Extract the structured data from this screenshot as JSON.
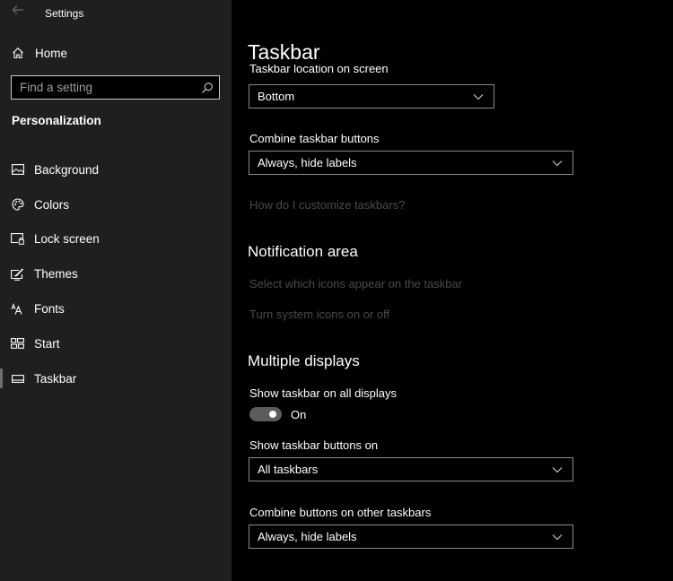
{
  "window": {
    "title": "Settings",
    "back_icon": "back-arrow-icon"
  },
  "sidebar": {
    "home": {
      "label": "Home",
      "icon": "home-icon"
    },
    "search": {
      "placeholder": "Find a setting",
      "value": "",
      "icon": "search-icon"
    },
    "section": "Personalization",
    "items": [
      {
        "label": "Background",
        "icon": "picture-icon",
        "active": false
      },
      {
        "label": "Colors",
        "icon": "palette-icon",
        "active": false
      },
      {
        "label": "Lock screen",
        "icon": "lock-screen-icon",
        "active": false
      },
      {
        "label": "Themes",
        "icon": "themes-icon",
        "active": false
      },
      {
        "label": "Fonts",
        "icon": "fonts-icon",
        "active": false
      },
      {
        "label": "Start",
        "icon": "start-icon",
        "active": false
      },
      {
        "label": "Taskbar",
        "icon": "taskbar-icon",
        "active": true
      }
    ]
  },
  "main": {
    "title": "Taskbar",
    "location": {
      "label": "Taskbar location on screen",
      "value": "Bottom"
    },
    "combine": {
      "label": "Combine taskbar buttons",
      "value": "Always, hide labels"
    },
    "help_link": "How do I customize taskbars?",
    "notification_area": {
      "title": "Notification area",
      "links": [
        "Select which icons appear on the taskbar",
        "Turn system icons on or off"
      ]
    },
    "multiple_displays": {
      "title": "Multiple displays",
      "show_all": {
        "label": "Show taskbar on all displays",
        "state": "On",
        "on": true
      },
      "buttons_on": {
        "label": "Show taskbar buttons on",
        "value": "All taskbars"
      },
      "combine_other": {
        "label": "Combine buttons on other taskbars",
        "value": "Always, hide labels"
      }
    }
  },
  "colors": {
    "sidebar_bg": "#1f1f1f",
    "main_bg": "#000000",
    "disabled_link": "#4a4a4a",
    "toggle_track": "#5c5c5c"
  }
}
